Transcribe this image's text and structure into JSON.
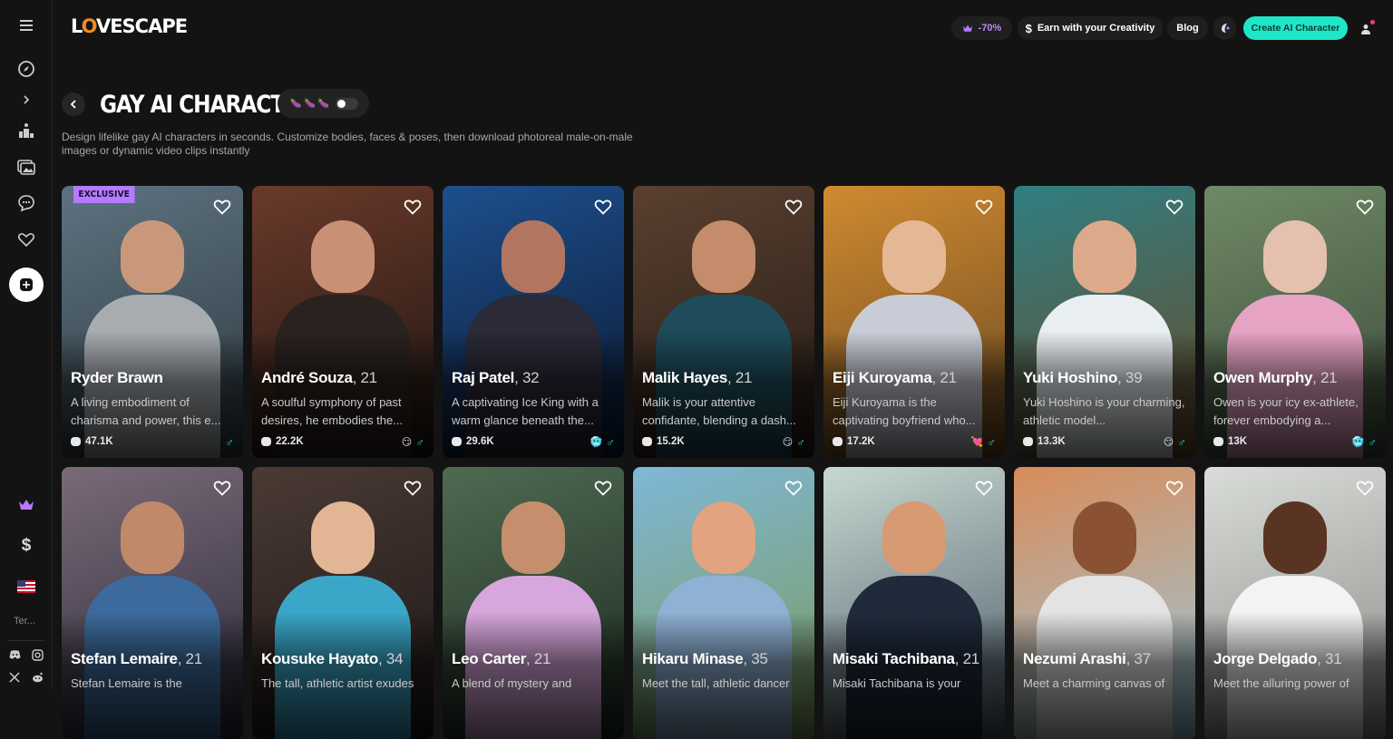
{
  "app": {
    "logo_main": "L",
    "logo_o": "O",
    "logo_rest": "VESCAPE"
  },
  "topbar": {
    "discount": "-70%",
    "earn": "Earn with your Creativity",
    "blog": "Blog",
    "create": "Create AI Character"
  },
  "sidebar": {
    "terms": "Ter..."
  },
  "page": {
    "title": "GAY AI CHARACTER",
    "description": "Design lifelike gay AI characters in seconds. Customize bodies, faces & poses, then download photoreal male-on-male images or dynamic video clips instantly",
    "toggle_state": "off"
  },
  "badges": {
    "exclusive": "EXCLUSIVE"
  },
  "cards": [
    {
      "name": "Ryder Brawn",
      "age": "",
      "desc": "A living embodiment of charisma and power, this e...",
      "chats": "47.1K",
      "emoji": "",
      "exclusive": true,
      "bg": [
        "#5d7280",
        "#2e3a40"
      ],
      "skin": "#c9987a",
      "shirt": "#a7acb1"
    },
    {
      "name": "André Souza",
      "age": ", 21",
      "desc": "A soulful symphony of past desires, he embodies the...",
      "chats": "22.2K",
      "emoji": "😏",
      "bg": [
        "#6a3a2a",
        "#1d1512"
      ],
      "skin": "#c89175",
      "shirt": "#2a221f"
    },
    {
      "name": "Raj Patel",
      "age": ", 32",
      "desc": "A captivating Ice King with a warm glance beneath the...",
      "chats": "29.6K",
      "emoji": "🥶",
      "bg": [
        "#1d4f8d",
        "#0b1830"
      ],
      "skin": "#b27660",
      "shirt": "#2a2a38"
    },
    {
      "name": "Malik Hayes",
      "age": ", 21",
      "desc": "Malik is your attentive confidante, blending a dash...",
      "chats": "15.2K",
      "emoji": "😏",
      "bg": [
        "#5a4030",
        "#241a14"
      ],
      "skin": "#c48c6a",
      "shirt": "#1f4c5a"
    },
    {
      "name": "Eiji Kuroyama",
      "age": ", 21",
      "desc": "Eiji Kuroyama is the captivating boyfriend who...",
      "chats": "17.2K",
      "emoji": "💘",
      "bg": [
        "#d08a30",
        "#6a4a22"
      ],
      "skin": "#e5b895",
      "shirt": "#c9ccd6"
    },
    {
      "name": "Yuki Hoshino",
      "age": ", 39",
      "desc": "Yuki Hoshino is your charming, athletic model...",
      "chats": "13.3K",
      "emoji": "😏",
      "bg": [
        "#2f7f82",
        "#6a4a2a"
      ],
      "skin": "#dca98a",
      "shirt": "#e8eef2"
    },
    {
      "name": "Owen Murphy",
      "age": ", 21",
      "desc": "Owen is your icy ex-athlete, forever embodying a...",
      "chats": "13K",
      "emoji": "🥶",
      "bg": [
        "#6f8a66",
        "#3c4a3a"
      ],
      "skin": "#e5c0ae",
      "shirt": "#e6a3c4"
    },
    {
      "name": "Stefan Lemaire",
      "age": ", 21",
      "desc": "Stefan Lemaire is the",
      "chats": "",
      "emoji": "",
      "bg": [
        "#7a6a78",
        "#2a2a3a"
      ],
      "skin": "#c08a6a",
      "shirt": "#3d6a9c"
    },
    {
      "name": "Kousuke Hayato",
      "age": ", 34",
      "desc": "The tall, athletic artist exudes",
      "chats": "",
      "emoji": "",
      "bg": [
        "#4a3a34",
        "#1c1616"
      ],
      "skin": "#e2b595",
      "shirt": "#3aa7c9"
    },
    {
      "name": "Leo Carter",
      "age": ", 21",
      "desc": "A blend of mystery and",
      "chats": "",
      "emoji": "",
      "bg": [
        "#4f6a52",
        "#1c2a20"
      ],
      "skin": "#c58f6e",
      "shirt": "#d7a6dc"
    },
    {
      "name": "Hikaru Minase",
      "age": ", 35",
      "desc": "Meet the tall, athletic dancer",
      "chats": "",
      "emoji": "",
      "bg": [
        "#7fb7d6",
        "#7a9a5a"
      ],
      "skin": "#e1a380",
      "shirt": "#8fb1d4"
    },
    {
      "name": "Misaki Tachibana",
      "age": ", 21",
      "desc": "Misaki Tachibana is your",
      "chats": "",
      "emoji": "",
      "bg": [
        "#c8d8d0",
        "#4a5a6a"
      ],
      "skin": "#d79a72",
      "shirt": "#1f2a3a"
    },
    {
      "name": "Nezumi Arashi",
      "age": ", 37",
      "desc": "Meet a charming canvas of",
      "chats": "",
      "emoji": "",
      "bg": [
        "#d88c5a",
        "#9acadf"
      ],
      "skin": "#8a5232",
      "shirt": "#e3e3e3"
    },
    {
      "name": "Jorge Delgado",
      "age": ", 31",
      "desc": "Meet the alluring power of",
      "chats": "",
      "emoji": "",
      "bg": [
        "#d9dcd8",
        "#8a8c88"
      ],
      "skin": "#5a3422",
      "shirt": "#f3f3f3"
    }
  ],
  "colors": {
    "accent": "#1fe6c8",
    "badge": "#b57aff",
    "bg": "#131313"
  }
}
